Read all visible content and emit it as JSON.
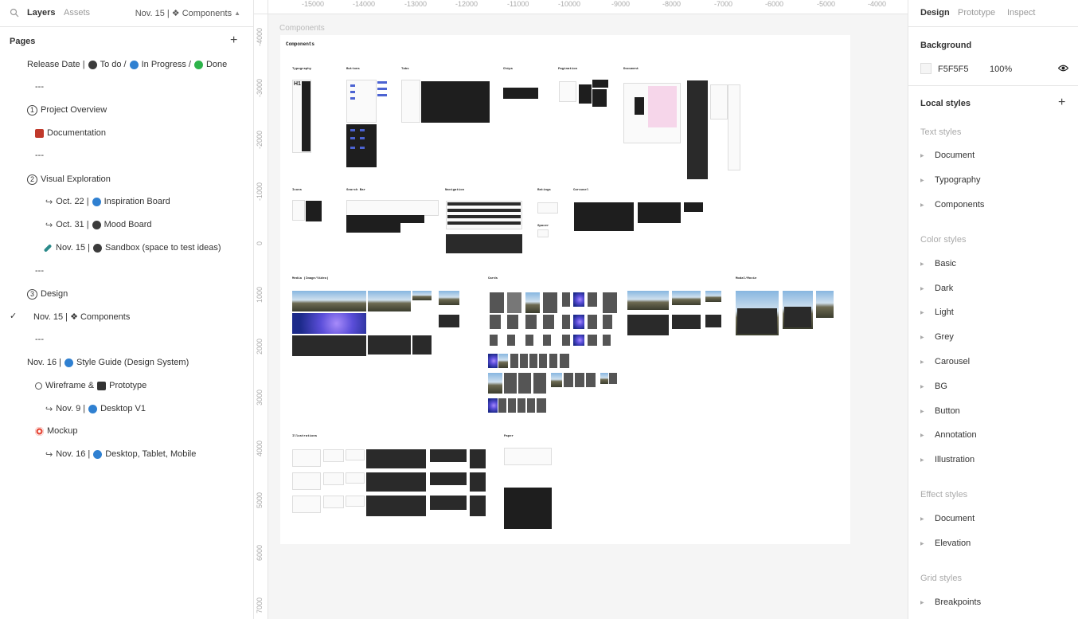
{
  "left_panel": {
    "tabs": {
      "layers": "Layers",
      "assets": "Assets"
    },
    "current_page": "Nov. 15 | ❖ Components",
    "pages_heading": "Pages",
    "pages": {
      "release_date": {
        "prefix": "Release Date |",
        "todo": "To do /",
        "inprogress": "In Progress /",
        "done": "Done"
      },
      "sep1": "---",
      "project_overview": {
        "num": "1",
        "label": "Project Overview"
      },
      "documentation": "Documentation",
      "sep2": "---",
      "visual_exploration": {
        "num": "2",
        "label": "Visual Exploration"
      },
      "inspiration": {
        "date": "Oct. 22 |",
        "label": "Inspiration Board"
      },
      "mood": {
        "date": "Oct. 31 |",
        "label": "Mood Board"
      },
      "sandbox": {
        "date": "Nov. 15 |",
        "label": "Sandbox (space to test ideas)"
      },
      "sep3": "---",
      "design": {
        "num": "3",
        "label": "Design"
      },
      "components": {
        "check": "✓",
        "label": "Nov. 15 | ❖ Components"
      },
      "sep4": "---",
      "style_guide": {
        "date": "Nov. 16 |",
        "label": "Style Guide (Design System)"
      },
      "wireframe": {
        "label1": "Wireframe &",
        "label2": "Prototype"
      },
      "desktop_v1": {
        "date": "Nov. 9 |",
        "label": "Desktop V1"
      },
      "mockup": "Mockup",
      "desktop_tablet": {
        "date": "Nov. 16 |",
        "label": "Desktop, Tablet, Mobile"
      }
    }
  },
  "canvas": {
    "ruler_top": [
      "-15000",
      "-14000",
      "-13000",
      "-12000",
      "-11000",
      "-10000",
      "-9000",
      "-8000",
      "-7000",
      "-6000",
      "-5000",
      "-4000"
    ],
    "ruler_left": [
      "-4000",
      "-3000",
      "-2000",
      "-1000",
      "0",
      "1000",
      "2000",
      "3000",
      "4000",
      "5000",
      "6000",
      "7000"
    ],
    "frame_label": "Components",
    "frame_title": "Components",
    "sections": {
      "typography": "Typography",
      "buttons": "Buttons",
      "tabs": "Tabs",
      "chips": "Chips",
      "pagination": "Pagination",
      "document": "Document",
      "icons": "Icons",
      "search_bar": "Search Bar",
      "navigation": "Navigation",
      "ratings": "Ratings",
      "carousel": "Carousel",
      "spacer": "Spacer",
      "media": "Media (Image/Video)",
      "cards": "Cards",
      "modal": "Modal/Movie",
      "illustrations": "Illustrations",
      "paper": "Paper"
    },
    "typography_sample": "H1"
  },
  "right_panel": {
    "tabs": {
      "design": "Design",
      "prototype": "Prototype",
      "inspect": "Inspect"
    },
    "background": {
      "title": "Background",
      "hex": "F5F5F5",
      "opacity": "100%"
    },
    "local_styles": "Local styles",
    "text_styles": {
      "title": "Text styles",
      "items": [
        "Document",
        "Typography",
        "Components"
      ]
    },
    "color_styles": {
      "title": "Color styles",
      "items": [
        "Basic",
        "Dark",
        "Light",
        "Grey",
        "Carousel",
        "BG",
        "Button",
        "Annotation",
        "Illustration"
      ]
    },
    "effect_styles": {
      "title": "Effect styles",
      "items": [
        "Document",
        "Elevation"
      ]
    },
    "grid_styles": {
      "title": "Grid styles",
      "items": [
        "Breakpoints"
      ]
    }
  }
}
